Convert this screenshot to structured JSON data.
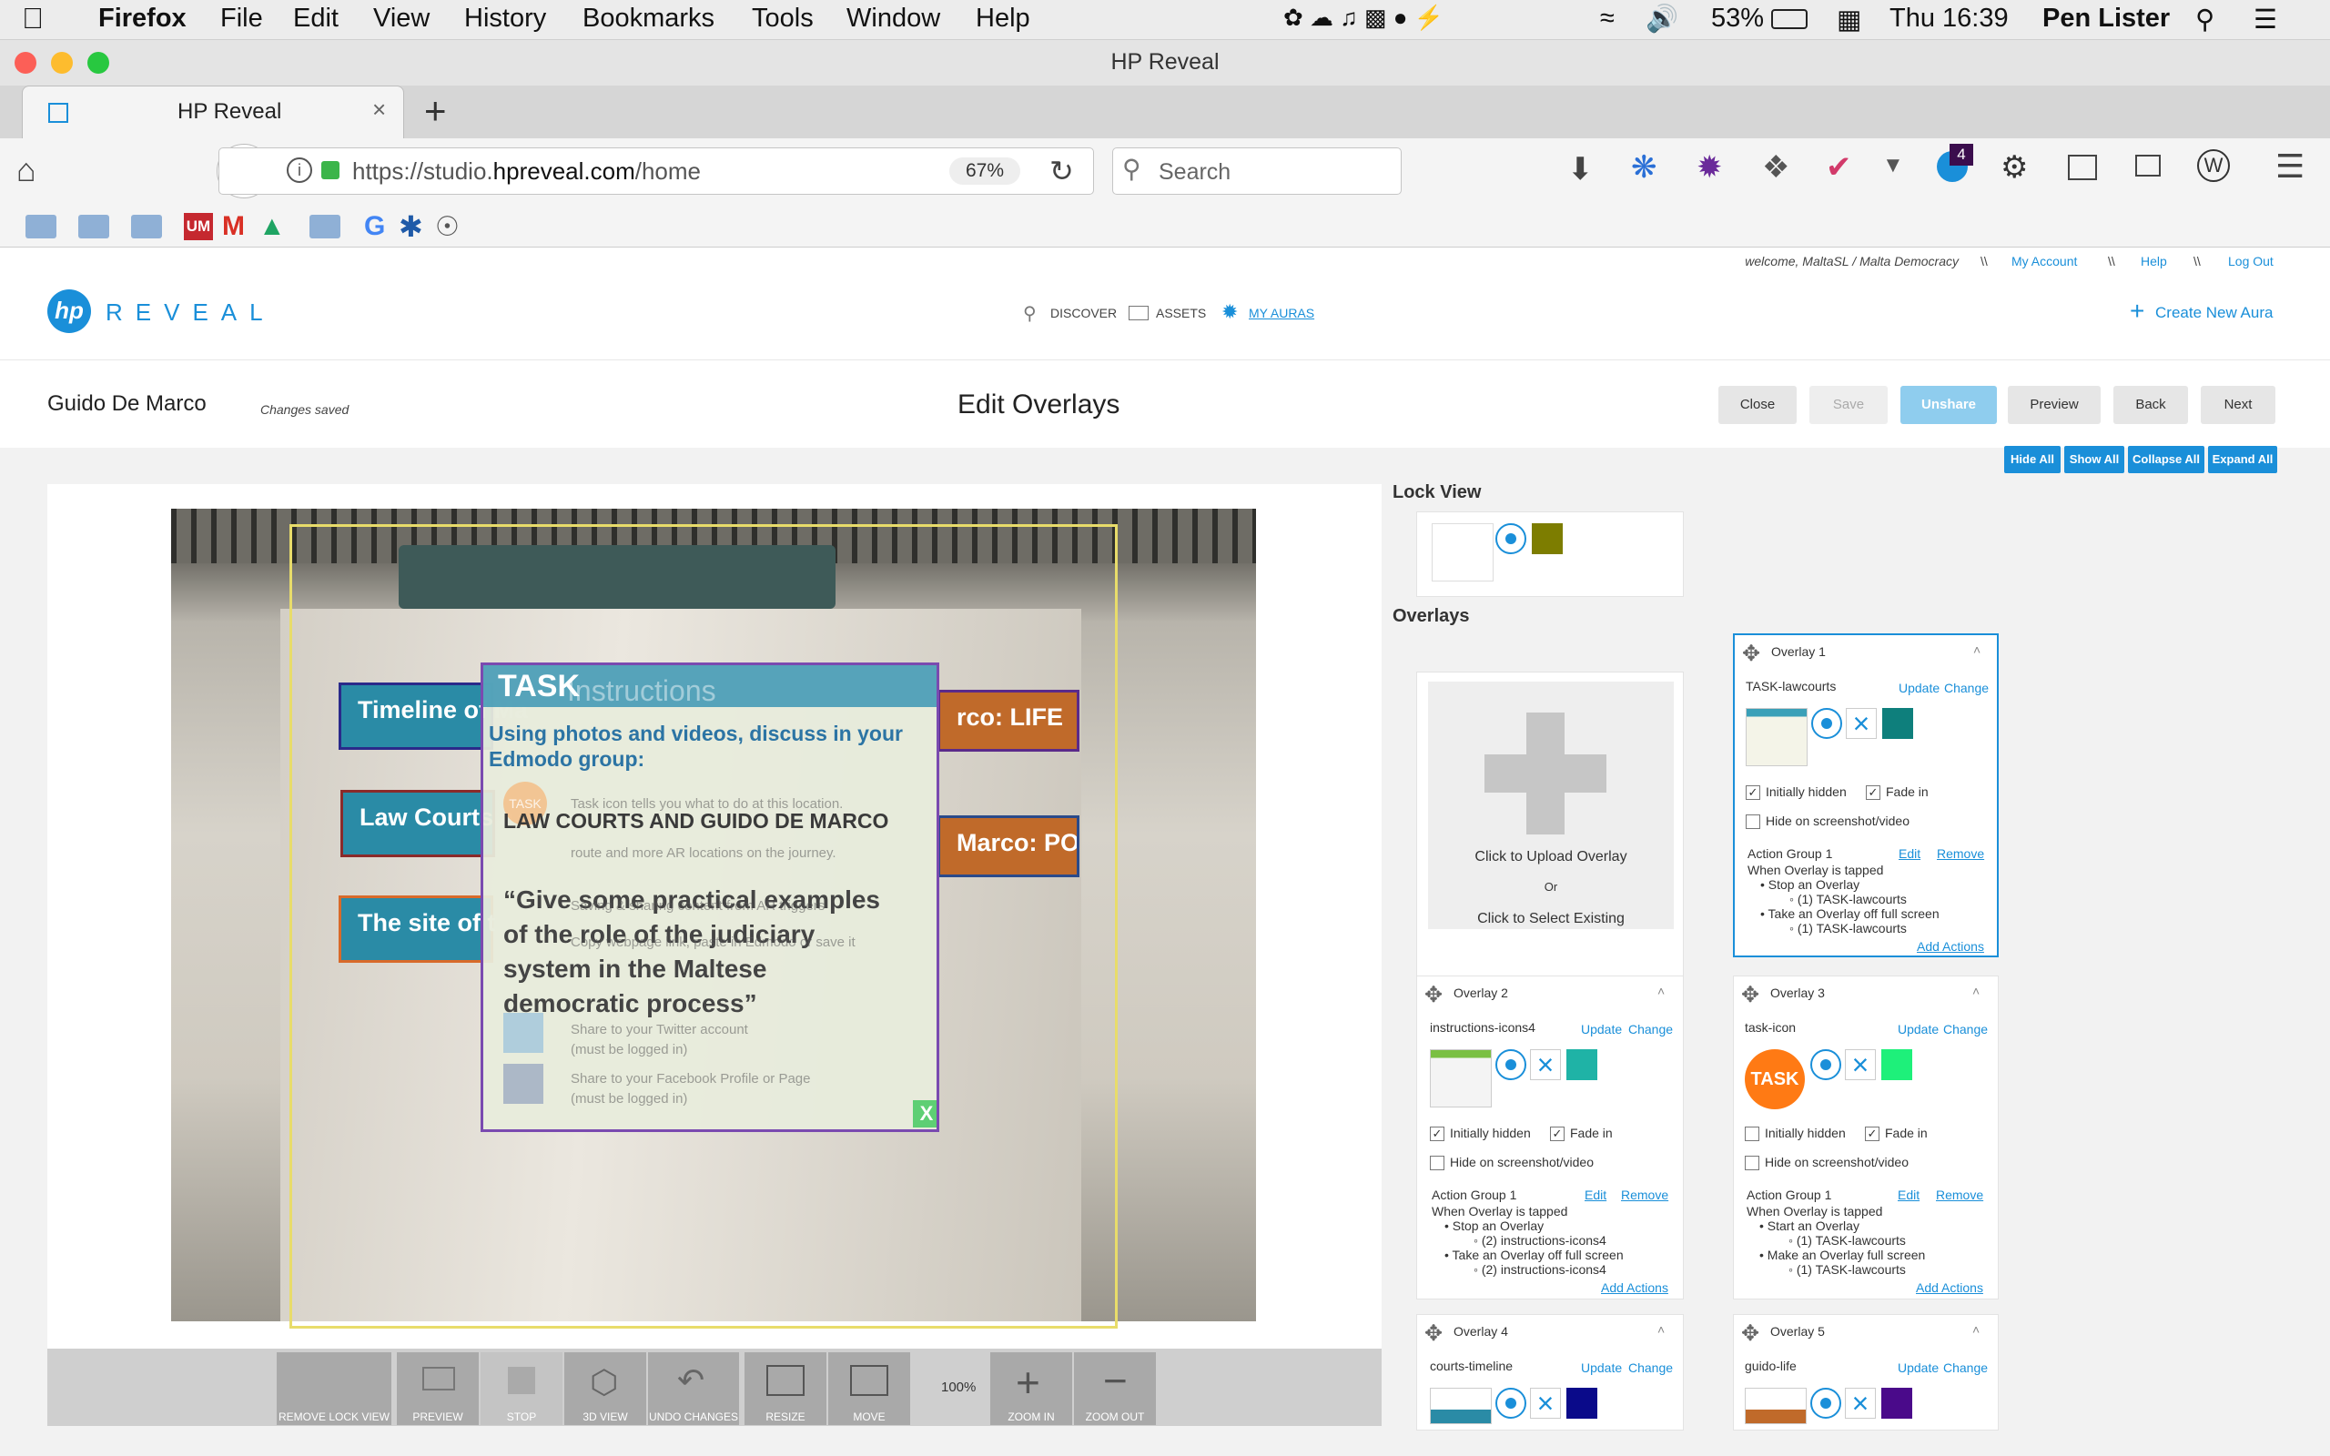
{
  "macos_menu": {
    "app": "Firefox",
    "items": [
      "File",
      "Edit",
      "View",
      "History",
      "Bookmarks",
      "Tools",
      "Window",
      "Help"
    ],
    "battery": "53%",
    "clock": "Thu 16:39",
    "user": "Pen Lister"
  },
  "window": {
    "title": "HP Reveal"
  },
  "tab": {
    "label": "HP Reveal"
  },
  "nav": {
    "url_prefix": "https://studio.",
    "url_domain": "hpreveal.com",
    "url_path": "/home",
    "zoom": "67%",
    "search_placeholder": "Search",
    "notification_count": "4"
  },
  "bookmarks": {
    "um": "UM"
  },
  "site": {
    "welcome": "welcome, MaltaSL / Malta Democracy",
    "separator": "\\\\",
    "my_account": "My Account",
    "help": "Help",
    "log_out": "Log Out",
    "logo_hp": "hp",
    "logo_text": "REVEAL",
    "nav_discover": "DISCOVER",
    "nav_assets": "ASSETS",
    "nav_my_auras": "MY AURAS",
    "create_new": "Create New Aura"
  },
  "editor": {
    "aura_name": "Guido De Marco",
    "status": "Changes saved",
    "title": "Edit Overlays",
    "buttons": {
      "close": "Close",
      "save": "Save",
      "unshare": "Unshare",
      "preview": "Preview",
      "back": "Back",
      "next": "Next"
    },
    "panel_buttons": {
      "hide_all": "Hide All",
      "show_all": "Show All",
      "collapse_all": "Collapse All",
      "expand_all": "Expand All"
    }
  },
  "canvas": {
    "task_title": "TASK",
    "instructions_ghost": "Instructions",
    "task_line1": "Using photos and videos, discuss in your",
    "task_line2": "Edmodo group:",
    "task_heading": "LAW COURTS AND GUIDO DE MARCO",
    "task_quote_lines": [
      "“Give some practical examples",
      "of the role of the judiciary",
      "system in the Maltese",
      "democratic process”"
    ],
    "ghost_lines": [
      "Task icon tells you what to do at this location.",
      "route and more AR locations on the journey.",
      "Saving & sharing content from AR triggers",
      "Copy webpage link, paste in Edmodo or save it",
      "Share to your Twitter account",
      "(must be logged in)",
      "Share to your Facebook Profile or Page",
      "(must be logged in)"
    ],
    "sign_timeline": "Timeline of Ma",
    "sign_lawcourts": "Law Courts a",
    "sign_site": "The site of t",
    "sign_life": "rco: LIFE",
    "sign_politics": "Marco: POLITICS",
    "ghost_task_icon": "TASK",
    "ghost_x": "X"
  },
  "toolbar": {
    "remove_lock_view": "REMOVE LOCK VIEW",
    "preview": "PREVIEW",
    "stop": "STOP",
    "view3d": "3D VIEW",
    "undo": "UNDO CHANGES",
    "resize": "RESIZE",
    "move": "MOVE",
    "zoom_level": "100%",
    "zoom_in": "ZOOM IN",
    "zoom_out": "ZOOM OUT"
  },
  "lock_view": {
    "title": "Lock View",
    "color": "#7d7d00"
  },
  "overlays_title": "Overlays",
  "upload": {
    "upload": "Click to Upload Overlay",
    "or": "Or",
    "select": "Click to Select Existing"
  },
  "labels": {
    "update": "Update",
    "change": "Change",
    "initially_hidden": "Initially hidden",
    "fade_in": "Fade in",
    "hide_on_screenshot": "Hide on screenshot/video",
    "edit": "Edit",
    "remove": "Remove",
    "add_actions": "Add Actions",
    "task": "TASK"
  },
  "overlays": [
    {
      "title": "Overlay 1",
      "name": "TASK-lawcourts",
      "color": "#0e7f7c",
      "initially_hidden": true,
      "fade_in": true,
      "hide_on_screenshot": false,
      "action_group": "Action Group 1",
      "trigger": "When Overlay is tapped",
      "actions": [
        {
          "action": "Stop an Overlay",
          "target": "(1) TASK-lawcourts"
        },
        {
          "action": "Take an Overlay off full screen",
          "target": "(1) TASK-lawcourts"
        }
      ]
    },
    {
      "title": "Overlay 2",
      "name": "instructions-icons4",
      "color": "#1fb3a6",
      "initially_hidden": true,
      "fade_in": true,
      "hide_on_screenshot": false,
      "action_group": "Action Group 1",
      "trigger": "When Overlay is tapped",
      "actions": [
        {
          "action": "Stop an Overlay",
          "target": "(2) instructions-icons4"
        },
        {
          "action": "Take an Overlay off full screen",
          "target": "(2) instructions-icons4"
        }
      ]
    },
    {
      "title": "Overlay 3",
      "name": "task-icon",
      "color": "#1ef07a",
      "initially_hidden": false,
      "fade_in": true,
      "hide_on_screenshot": false,
      "action_group": "Action Group 1",
      "trigger": "When Overlay is tapped",
      "actions": [
        {
          "action": "Start an Overlay",
          "target": "(1) TASK-lawcourts"
        },
        {
          "action": "Make an Overlay full screen",
          "target": "(1) TASK-lawcourts"
        }
      ]
    },
    {
      "title": "Overlay 4",
      "name": "courts-timeline",
      "color": "#0a0a8a"
    },
    {
      "title": "Overlay 5",
      "name": "guido-life",
      "color": "#4a0a8a"
    }
  ]
}
